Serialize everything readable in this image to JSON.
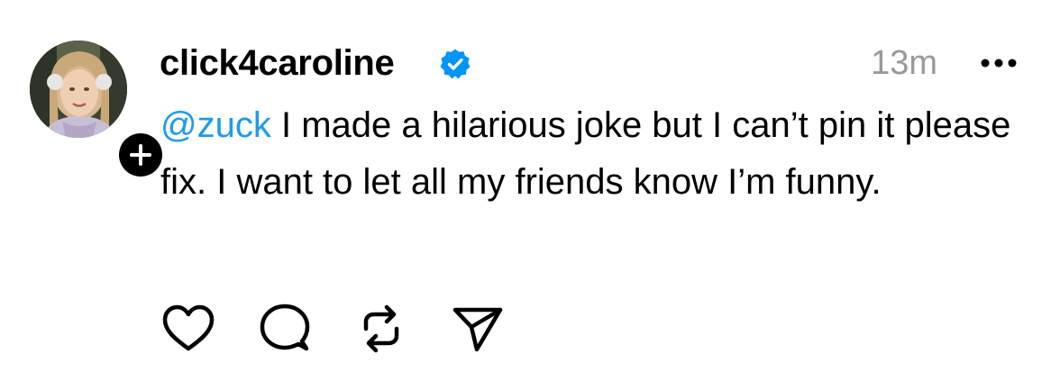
{
  "post": {
    "author": {
      "username": "click4caroline",
      "verified": true,
      "avatar_icon": "profile-photo",
      "follow_icon": "plus-icon"
    },
    "timestamp": "13m",
    "more_icon": "more-horizontal-icon",
    "body": {
      "mention": "@zuck",
      "text": " I made a hilarious joke but I can’t pin it please fix. I want to let all my friends know I’m funny."
    },
    "actions": {
      "like_icon": "heart-icon",
      "reply_icon": "comment-icon",
      "repost_icon": "repost-icon",
      "share_icon": "send-icon"
    },
    "colors": {
      "mention": "#1d9bf0",
      "verified": "#0095f6",
      "timestamp": "#999999"
    }
  }
}
